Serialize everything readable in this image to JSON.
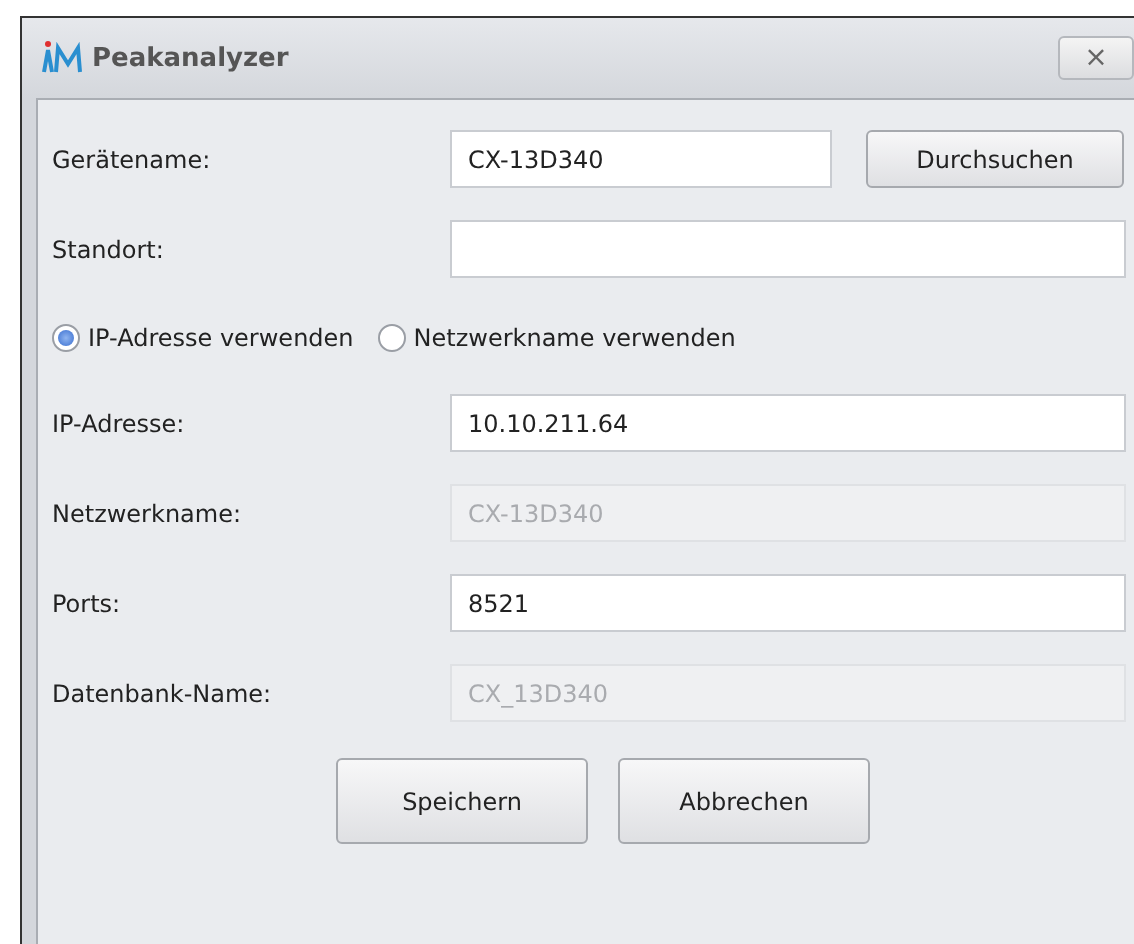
{
  "window": {
    "title": "Peakanalyzer",
    "close": "×"
  },
  "rows": [
    {
      "kind": "field",
      "label": "Gerätename:",
      "value": "CX-13D340",
      "disabled": false,
      "button": "Durchsuchen"
    },
    {
      "kind": "field",
      "label": "Standort:",
      "value": "",
      "disabled": false
    },
    {
      "kind": "radios",
      "options": [
        {
          "label": "IP-Adresse verwenden",
          "selected": true
        },
        {
          "label": "Netzwerkname verwenden",
          "selected": false
        }
      ]
    },
    {
      "kind": "field",
      "label": "IP-Adresse:",
      "value": "10.10.211.64",
      "disabled": false
    },
    {
      "kind": "field",
      "label": "Netzwerkname:",
      "value": "CX-13D340",
      "disabled": true
    },
    {
      "kind": "field",
      "label": "Ports:",
      "value": "8521",
      "disabled": false
    },
    {
      "kind": "field",
      "label": "Datenbank-Name:",
      "value": "CX_13D340",
      "disabled": true
    }
  ],
  "buttons": [
    "Speichern",
    "Abbrechen"
  ]
}
